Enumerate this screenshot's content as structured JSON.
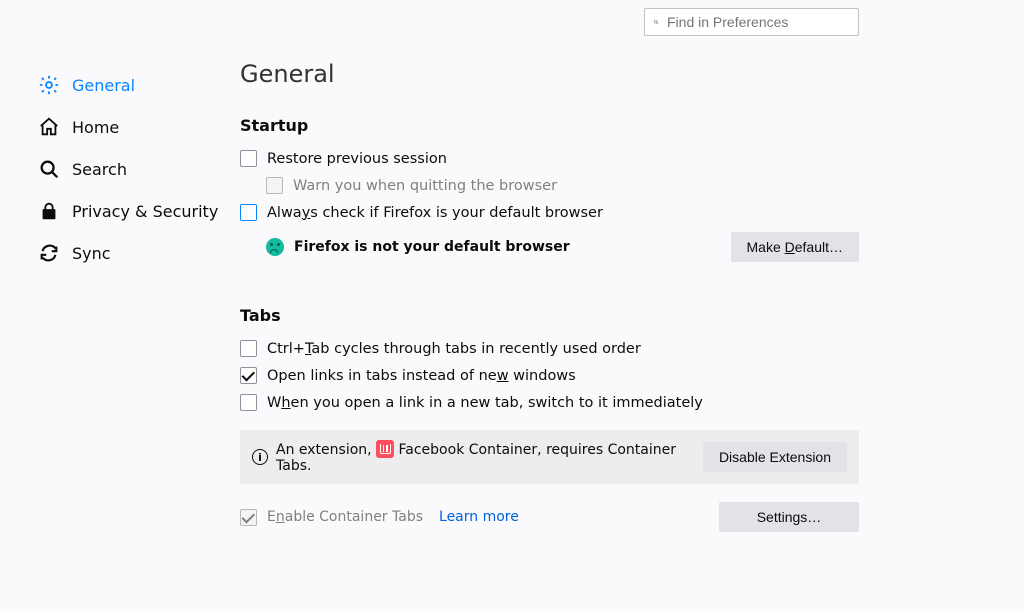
{
  "search": {
    "placeholder": "Find in Preferences"
  },
  "sidebar": {
    "items": [
      {
        "label": "General"
      },
      {
        "label": "Home"
      },
      {
        "label": "Search"
      },
      {
        "label": "Privacy & Security"
      },
      {
        "label": "Sync"
      }
    ]
  },
  "title": "General",
  "startup": {
    "heading": "Startup",
    "restore": "Restore previous session",
    "warn": "Warn you when quitting the browser",
    "always_pre": "Alwa",
    "always_u": "y",
    "always_post": "s check if Firefox is your default browser",
    "not_default": "Firefox is not your default browser",
    "make_default_pre": "Make ",
    "make_default_u": "D",
    "make_default_post": "efault…"
  },
  "tabs": {
    "heading": "Tabs",
    "cycle_pre": "Ctrl+",
    "cycle_u": "T",
    "cycle_post": "ab cycles through tabs in recently used order",
    "open_pre": "Open links in tabs instead of ne",
    "open_u": "w",
    "open_post": " windows",
    "switch_pre": "W",
    "switch_u": "h",
    "switch_post": "en you open a link in a new tab, switch to it immediately",
    "notice_pre": "An extension, ",
    "notice_name": "Facebook Container",
    "notice_post": ", requires Container Tabs.",
    "disable": "Disable Extension",
    "container_pre": "E",
    "container_u": "n",
    "container_post": "able Container Tabs",
    "learn": "Learn more",
    "settings": "Settings…"
  }
}
